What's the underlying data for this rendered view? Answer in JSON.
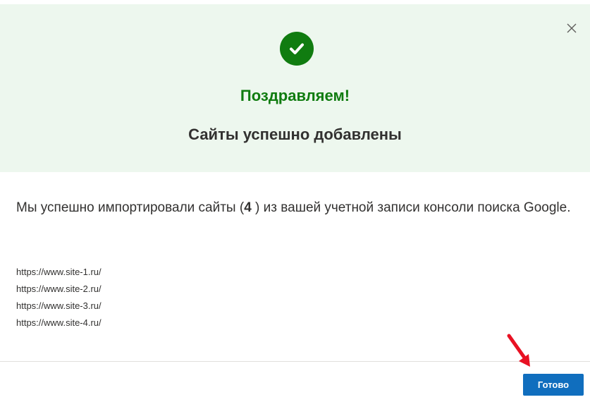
{
  "dialog": {
    "close_icon": "close-icon",
    "success_icon": "checkmark-circle-icon",
    "success_color": "#107c10",
    "title": "Поздравляем!",
    "subtitle": "Сайты успешно добавлены",
    "message_before": "Мы успешно импортировали сайты (",
    "site_count": "4",
    "message_after": " ) из вашей учетной записи консоли поиска Google.",
    "sites": [
      "https://www.site-1.ru/",
      "https://www.site-2.ru/",
      "https://www.site-3.ru/",
      "https://www.site-4.ru/"
    ],
    "done_label": "Готово",
    "primary_color": "#106ebe",
    "annotation_arrow_color": "#e81123"
  }
}
